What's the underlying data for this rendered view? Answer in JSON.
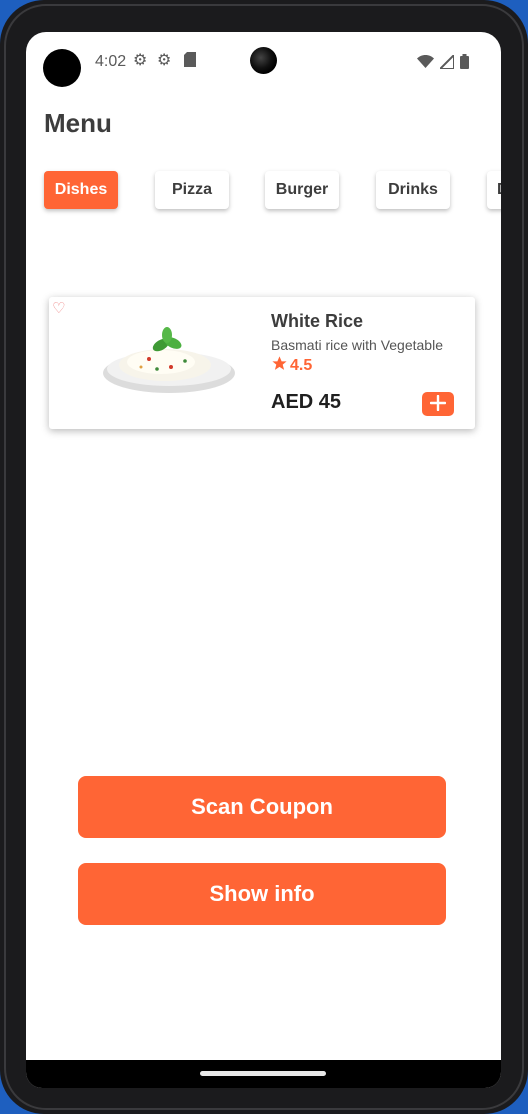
{
  "status_bar": {
    "time": "4:02",
    "left_icons": [
      "settings-icon",
      "settings-icon",
      "sd-card-icon"
    ],
    "right_icons": [
      "wifi-icon",
      "signal-icon",
      "battery-icon"
    ]
  },
  "header": {
    "title": "Menu"
  },
  "categories": {
    "selected": "Dishes",
    "items": [
      {
        "label": "Dishes"
      },
      {
        "label": "Pizza"
      },
      {
        "label": "Burger"
      },
      {
        "label": "Drinks"
      },
      {
        "label": "D"
      }
    ]
  },
  "dishes": [
    {
      "name": "White Rice",
      "description": "Basmati rice with Vegetable",
      "rating": "4.5",
      "price": "AED 45",
      "favorite_icon": "heart-outline-icon",
      "add_icon": "plus-icon"
    }
  ],
  "actions": {
    "scan_coupon": "Scan Coupon",
    "show_info": "Show info"
  },
  "colors": {
    "accent": "#ff6535",
    "text_dark": "#3d3d3d",
    "background": "#ffffff"
  }
}
